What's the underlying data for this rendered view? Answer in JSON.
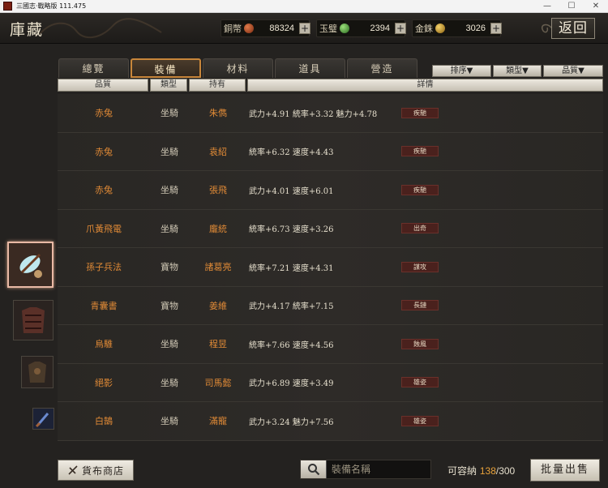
{
  "window": {
    "title": "三國志·戰略版 111.475",
    "minimize": "—",
    "maximize": "☐",
    "close": "✕"
  },
  "header": {
    "title": "庫藏",
    "back_label": "返回",
    "currencies": [
      {
        "label": "銅幣",
        "value": "88324",
        "color": "#b0502a"
      },
      {
        "label": "玉璧",
        "value": "2394",
        "color": "#4caa4a"
      },
      {
        "label": "金銖",
        "value": "3026",
        "color": "#d1a62c"
      }
    ],
    "plus": "+"
  },
  "tabs": [
    {
      "label": "總覽",
      "active": false
    },
    {
      "label": "裝備",
      "active": true
    },
    {
      "label": "材料",
      "active": false
    },
    {
      "label": "道具",
      "active": false
    },
    {
      "label": "營造",
      "active": false
    }
  ],
  "filters": [
    "排序▼",
    "類型▼",
    "品質▼"
  ],
  "columns": {
    "quality": "品質",
    "type": "類型",
    "holder": "持有",
    "detail": "詳情"
  },
  "items": [
    {
      "name": "赤兔",
      "type": "坐騎",
      "holder": "朱儁",
      "stats": "武力+4.91  統率+3.32  魅力+4.78",
      "tag": "疾馳"
    },
    {
      "name": "赤兔",
      "type": "坐騎",
      "holder": "袁紹",
      "stats": "統率+6.32  速度+4.43",
      "tag": "疾馳"
    },
    {
      "name": "赤兔",
      "type": "坐騎",
      "holder": "張飛",
      "stats": "武力+4.01  速度+6.01",
      "tag": "疾馳"
    },
    {
      "name": "爪黃飛電",
      "type": "坐騎",
      "holder": "龐統",
      "stats": "統率+6.73  速度+3.26",
      "tag": "出奇"
    },
    {
      "name": "孫子兵法",
      "type": "寶物",
      "holder": "諸葛亮",
      "stats": "統率+7.21  速度+4.31",
      "tag": "謀攻"
    },
    {
      "name": "青囊書",
      "type": "寶物",
      "holder": "姜維",
      "stats": "武力+4.17  統率+7.15",
      "tag": "長鏈"
    },
    {
      "name": "烏騅",
      "type": "坐騎",
      "holder": "程昱",
      "stats": "統率+7.66  速度+4.56",
      "tag": "蝕風"
    },
    {
      "name": "絕影",
      "type": "坐騎",
      "holder": "司馬懿",
      "stats": "武力+6.89  速度+3.49",
      "tag": "雄姿"
    },
    {
      "name": "白鵠",
      "type": "坐騎",
      "holder": "滿寵",
      "stats": "武力+3.24  魅力+7.56",
      "tag": "雄姿"
    }
  ],
  "footer": {
    "shop_label": "貨布商店",
    "search_placeholder": "裝備名稱",
    "capacity_label": "可容納",
    "capacity_current": "138",
    "capacity_max": "/300",
    "sell_label": "批量出售"
  }
}
